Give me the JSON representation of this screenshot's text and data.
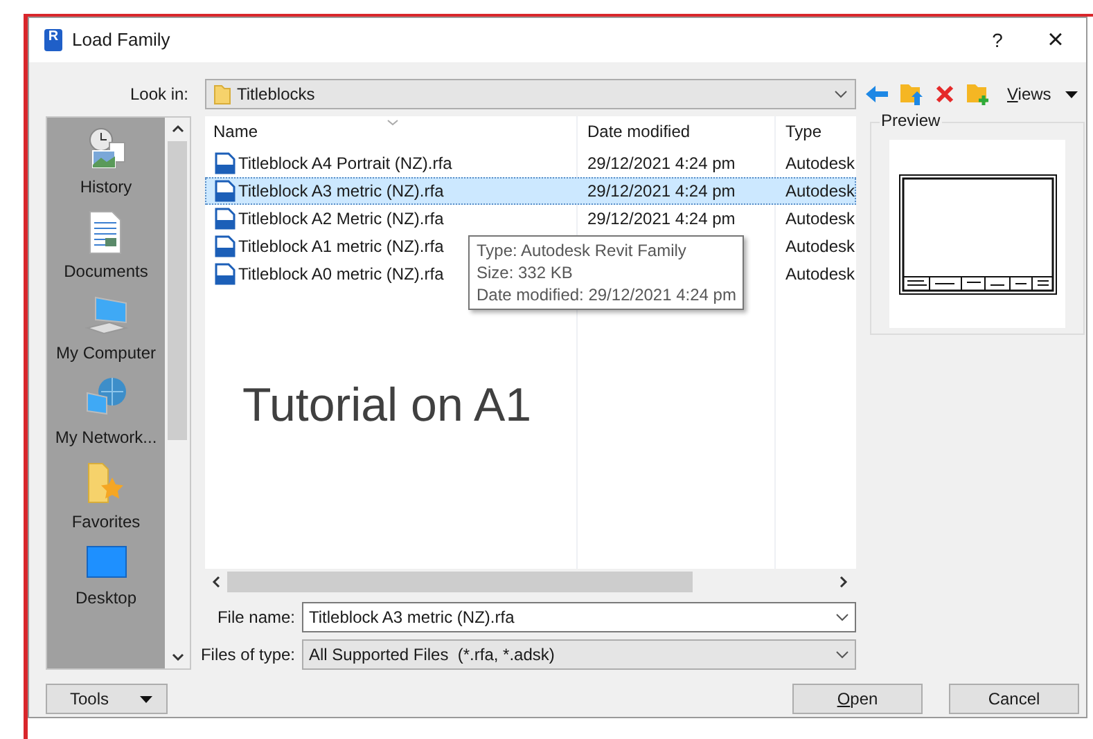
{
  "window": {
    "icon_letter": "R",
    "title": "Load Family",
    "help": "?",
    "close": "×"
  },
  "look_in": {
    "label": "Look in:",
    "value": "Titleblocks"
  },
  "toolbar": {
    "views": "Views"
  },
  "places": [
    {
      "label": "History",
      "kind": "history"
    },
    {
      "label": "Documents",
      "kind": "documents"
    },
    {
      "label": "My Computer",
      "kind": "computer"
    },
    {
      "label": "My Network...",
      "kind": "network"
    },
    {
      "label": "Favorites",
      "kind": "favorites"
    },
    {
      "label": "Desktop",
      "kind": "desktop"
    }
  ],
  "file_list": {
    "columns": [
      "Name",
      "Date modified",
      "Type"
    ],
    "rows": [
      {
        "name": "Titleblock A4 Portrait (NZ).rfa",
        "date": "29/12/2021 4:24 pm",
        "type": "Autodesk",
        "selected": false
      },
      {
        "name": "Titleblock A3 metric (NZ).rfa",
        "date": "29/12/2021 4:24 pm",
        "type": "Autodesk",
        "selected": true
      },
      {
        "name": "Titleblock A2 Metric (NZ).rfa",
        "date": "29/12/2021 4:24 pm",
        "type": "Autodesk",
        "selected": false
      },
      {
        "name": "Titleblock A1 metric (NZ).rfa",
        "type": "Autodesk",
        "selected": false
      },
      {
        "name": "Titleblock A0 metric (NZ).rfa",
        "type": "Autodesk",
        "selected": false
      }
    ]
  },
  "tooltip": {
    "lines": [
      "Type: Autodesk Revit Family",
      "Size: 332 KB",
      "Date modified: 29/12/2021 4:24 pm"
    ]
  },
  "annotation": "Tutorial on A1",
  "preview": {
    "label": "Preview"
  },
  "file_name": {
    "label": "File name:",
    "value": "Titleblock A3 metric (NZ).rfa"
  },
  "file_type": {
    "label": "Files of type:",
    "value": "All Supported Files  (*.rfa, *.adsk)"
  },
  "buttons": {
    "tools": "Tools",
    "open": "Open",
    "cancel": "Cancel"
  }
}
